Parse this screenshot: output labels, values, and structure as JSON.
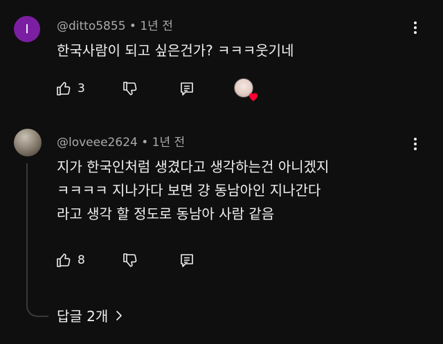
{
  "comments": [
    {
      "avatar_initial": "I",
      "avatar_color": "#7b1fa2",
      "handle": "@ditto5855",
      "time": "1년 전",
      "text_lines": [
        "한국사람이 되고 싶은건가? ㅋㅋㅋ웃기네"
      ],
      "likes": "3",
      "creator_heart": true
    },
    {
      "handle": "@loveee2624",
      "time": "1년 전",
      "text_lines": [
        "지가 한국인처럼 생겼다고 생각하는건 아니겠지",
        "ㅋㅋㅋㅋ 지나가다 보면 걍 동남아인 지나간다",
        "라고 생각 할 정도로 동남아 사람 같음"
      ],
      "likes": "8",
      "creator_heart": false
    }
  ],
  "replies": {
    "label": "답글 2개"
  },
  "icons": {
    "like": "thumbs-up-icon",
    "dislike": "thumbs-down-icon",
    "reply": "reply-icon",
    "menu": "more-vert-icon",
    "chevron": "chevron-right-icon"
  },
  "colors": {
    "heart": "#ff0033",
    "background": "#0f0f0f",
    "muted_text": "#aaaaaa"
  }
}
